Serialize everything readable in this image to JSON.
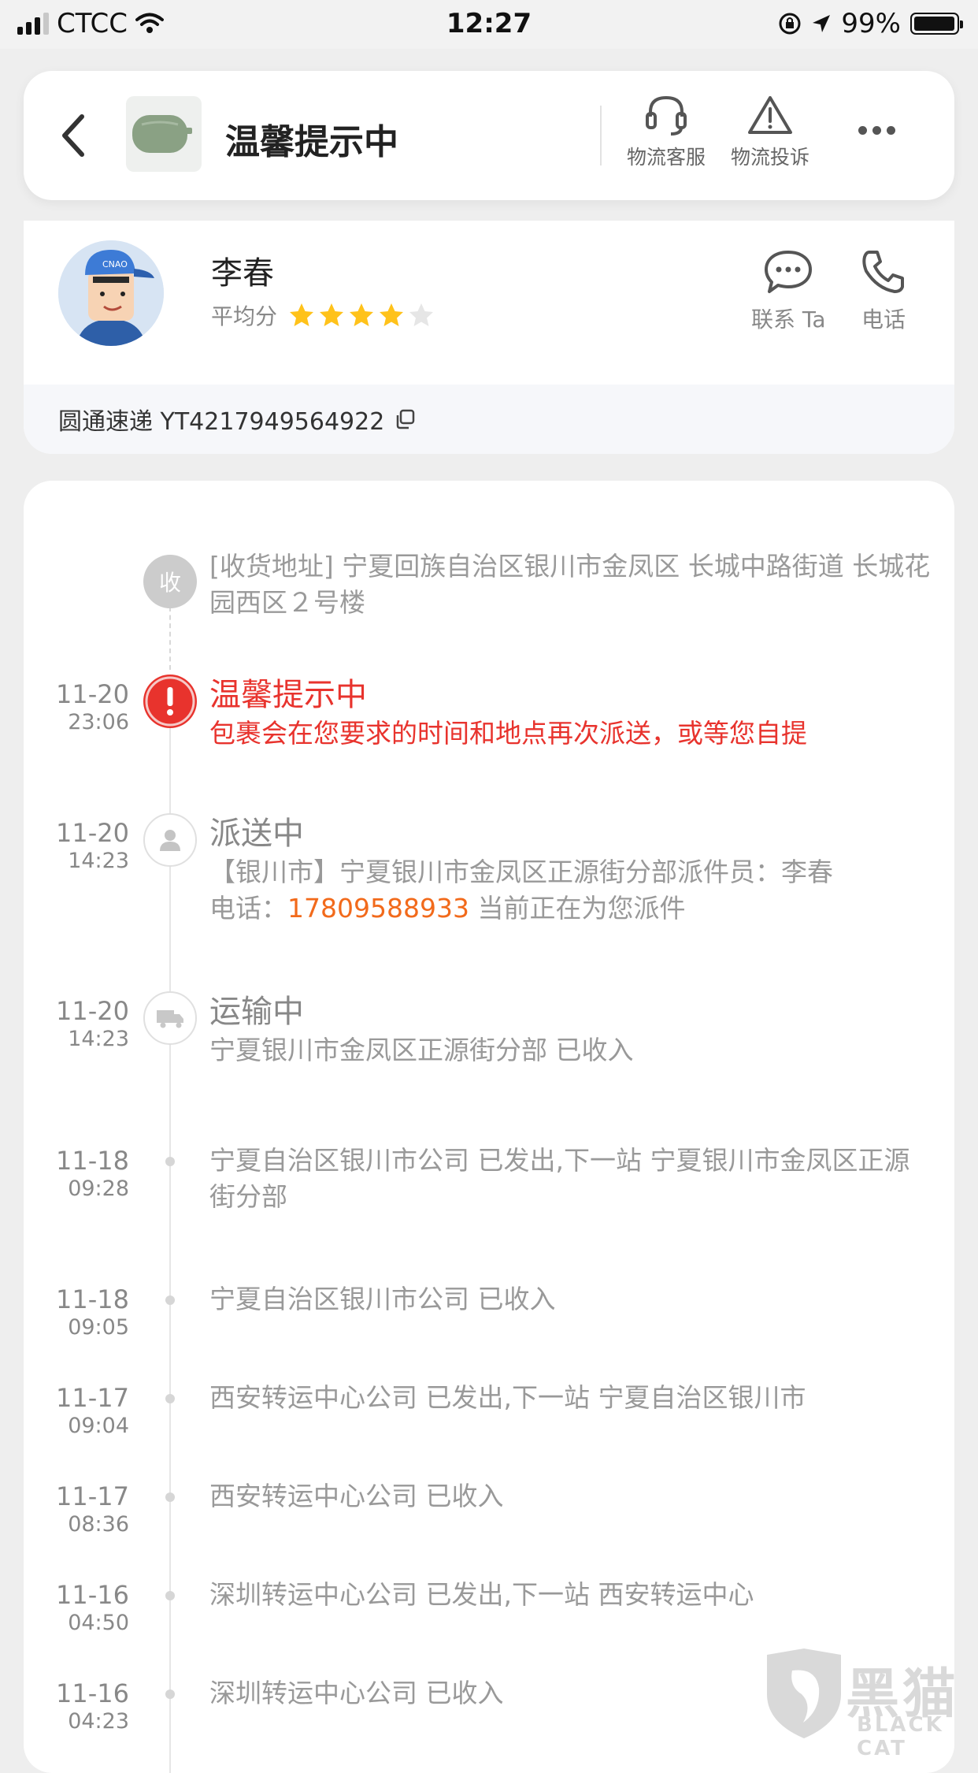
{
  "status_bar": {
    "carrier": "CTCC",
    "time": "12:27",
    "battery": "99%",
    "battery_level": 0.99
  },
  "header": {
    "title": "温馨提示中",
    "actions": [
      {
        "label": "物流客服",
        "icon": "headset-icon"
      },
      {
        "label": "物流投诉",
        "icon": "warning-icon"
      }
    ]
  },
  "courier": {
    "name": "李春",
    "rating_label": "平均分",
    "rating": 4,
    "rating_max": 5,
    "contact_label": "联系 Ta",
    "phone_label": "电话",
    "tracking": "圆通速递 YT4217949564922"
  },
  "timeline": {
    "address": {
      "node": "收",
      "text": "[收货地址] 宁夏回族自治区银川市金凤区  长城中路街道   长城花园西区２号楼"
    },
    "events": [
      {
        "date": "11-20",
        "time": "23:06",
        "status": "温馨提示中",
        "desc": "包裹会在您要求的时间和地点再次派送，或等您自提"
      },
      {
        "date": "11-20",
        "time": "14:23",
        "status": "派送中",
        "desc": "【银川市】宁夏银川市金凤区正源街分部派件员：李春",
        "desc2_prefix": "电话：",
        "phone": "17809588933",
        "desc2_suffix": " 当前正在为您派件"
      },
      {
        "date": "11-20",
        "time": "14:23",
        "status": "运输中",
        "desc": "宁夏银川市金凤区正源街分部 已收入"
      },
      {
        "date": "11-18",
        "time": "09:28",
        "desc": "宁夏自治区银川市公司 已发出,下一站 宁夏银川市金凤区正源街分部"
      },
      {
        "date": "11-18",
        "time": "09:05",
        "desc": "宁夏自治区银川市公司 已收入"
      },
      {
        "date": "11-17",
        "time": "09:04",
        "desc": "西安转运中心公司 已发出,下一站 宁夏自治区银川市"
      },
      {
        "date": "11-17",
        "time": "08:36",
        "desc": "西安转运中心公司 已收入"
      },
      {
        "date": "11-16",
        "time": "04:50",
        "desc": "深圳转运中心公司 已发出,下一站 西安转运中心"
      },
      {
        "date": "11-16",
        "time": "04:23",
        "desc": "深圳转运中心公司 已收入"
      }
    ]
  },
  "watermark": {
    "text": "黑猫",
    "sub": "BLACK CAT"
  },
  "colors": {
    "accent_red": "#e8332d",
    "phone_orange": "#f26a1b",
    "star": "#ffc21a"
  }
}
